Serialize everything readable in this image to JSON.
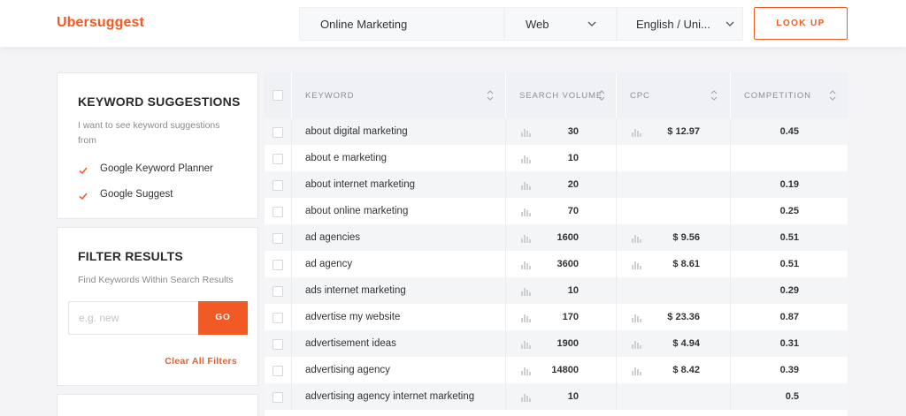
{
  "header": {
    "logo": "Ubersuggest",
    "search_value": "Online Marketing",
    "source_select": "Web",
    "language_select": "English / Uni...",
    "lookup_label": "LOOK UP"
  },
  "sidebar": {
    "suggestions": {
      "title": "KEYWORD SUGGESTIONS",
      "description": "I want to see keyword suggestions from",
      "options": [
        {
          "label": "Google Keyword Planner",
          "checked": true
        },
        {
          "label": "Google Suggest",
          "checked": true
        }
      ]
    },
    "filter": {
      "title": "FILTER RESULTS",
      "description": "Find Keywords Within Search Results",
      "placeholder": "e.g. new",
      "go_label": "GO",
      "clear_label": "Clear All Filters"
    }
  },
  "table": {
    "columns": [
      "KEYWORD",
      "SEARCH VOLUME",
      "CPC",
      "COMPETITION"
    ],
    "rows": [
      {
        "keyword": "about digital marketing",
        "volume": "30",
        "cpc": "$ 12.97",
        "competition": "0.45"
      },
      {
        "keyword": "about e marketing",
        "volume": "10",
        "cpc": "",
        "competition": ""
      },
      {
        "keyword": "about internet marketing",
        "volume": "20",
        "cpc": "",
        "competition": "0.19"
      },
      {
        "keyword": "about online marketing",
        "volume": "70",
        "cpc": "",
        "competition": "0.25"
      },
      {
        "keyword": "ad agencies",
        "volume": "1600",
        "cpc": "$ 9.56",
        "competition": "0.51"
      },
      {
        "keyword": "ad agency",
        "volume": "3600",
        "cpc": "$ 8.61",
        "competition": "0.51"
      },
      {
        "keyword": "ads internet marketing",
        "volume": "10",
        "cpc": "",
        "competition": "0.29"
      },
      {
        "keyword": "advertise my website",
        "volume": "170",
        "cpc": "$ 23.36",
        "competition": "0.87"
      },
      {
        "keyword": "advertisement ideas",
        "volume": "1900",
        "cpc": "$ 4.94",
        "competition": "0.31"
      },
      {
        "keyword": "advertising agency",
        "volume": "14800",
        "cpc": "$ 8.42",
        "competition": "0.39"
      },
      {
        "keyword": "advertising agency internet marketing",
        "volume": "10",
        "cpc": "",
        "competition": "0.5"
      }
    ]
  },
  "colors": {
    "accent": "#f15a24",
    "background": "#f4f4f6",
    "header_row": "#f0f1f4",
    "striped_row": "#f4f5f7"
  },
  "icons": [
    "chevron-down-icon",
    "checkmark-icon",
    "sort-icon",
    "bar-chart-icon"
  ]
}
